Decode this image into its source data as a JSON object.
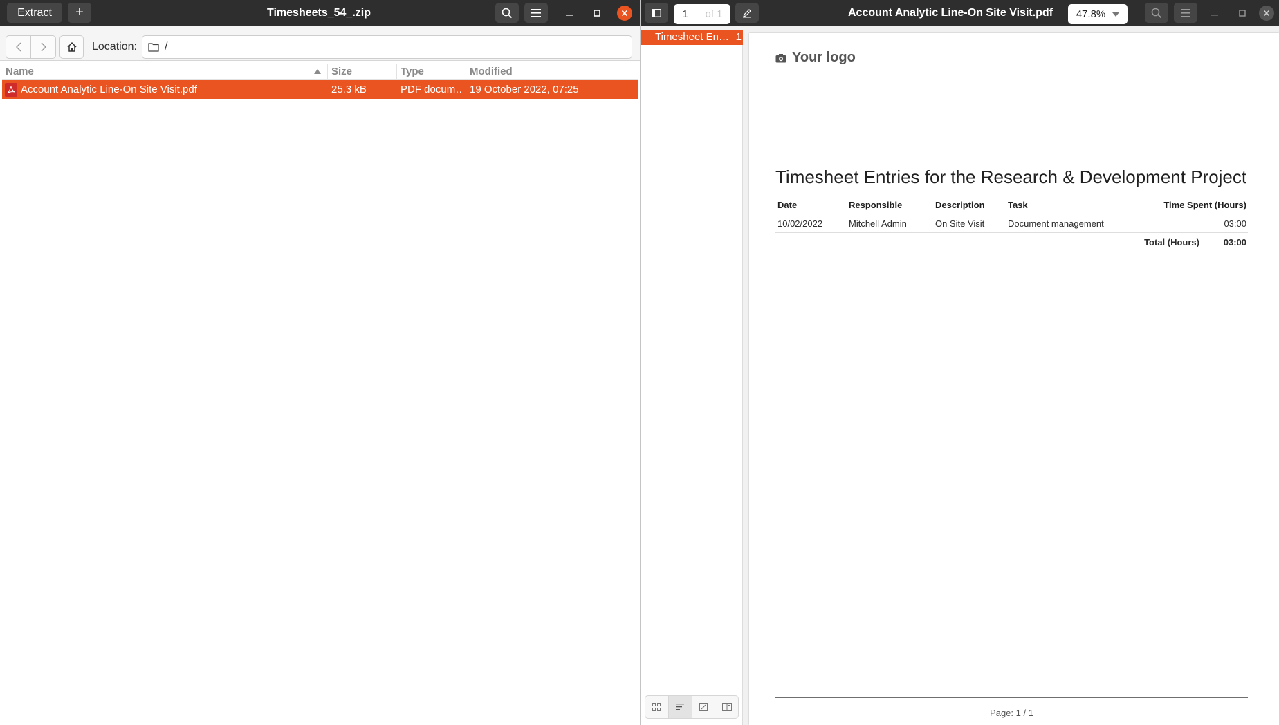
{
  "archive": {
    "title": "Timesheets_54_.zip",
    "extract_label": "Extract",
    "add_label": "+",
    "location_label": "Location:",
    "location_value": "/",
    "columns": {
      "name": "Name",
      "size": "Size",
      "type": "Type",
      "modified": "Modified"
    },
    "files": [
      {
        "name": "Account Analytic Line-On Site Visit.pdf",
        "size": "25.3 kB",
        "type": "PDF docum…",
        "modified": "19 October 2022, 07:25"
      }
    ]
  },
  "viewer": {
    "title": "Account Analytic Line-On Site Visit.pdf",
    "page_current": "1",
    "page_of": "of 1",
    "zoom": "47.8%",
    "outline": [
      {
        "title": "Timesheet En…",
        "page": "1"
      }
    ]
  },
  "document": {
    "logo_text": "Your logo",
    "heading": "Timesheet Entries for the Research & Development Project",
    "table": {
      "headers": [
        "Date",
        "Responsible",
        "Description",
        "Task",
        "Time Spent (Hours)"
      ],
      "rows": [
        [
          "10/02/2022",
          "Mitchell Admin",
          "On Site Visit",
          "Document management",
          "03:00"
        ]
      ],
      "total_label": "Total (Hours)",
      "total_value": "03:00"
    },
    "footer": "Page: 1 / 1"
  },
  "colors": {
    "accent": "#e95420",
    "headerbar": "#2e2e2e"
  }
}
